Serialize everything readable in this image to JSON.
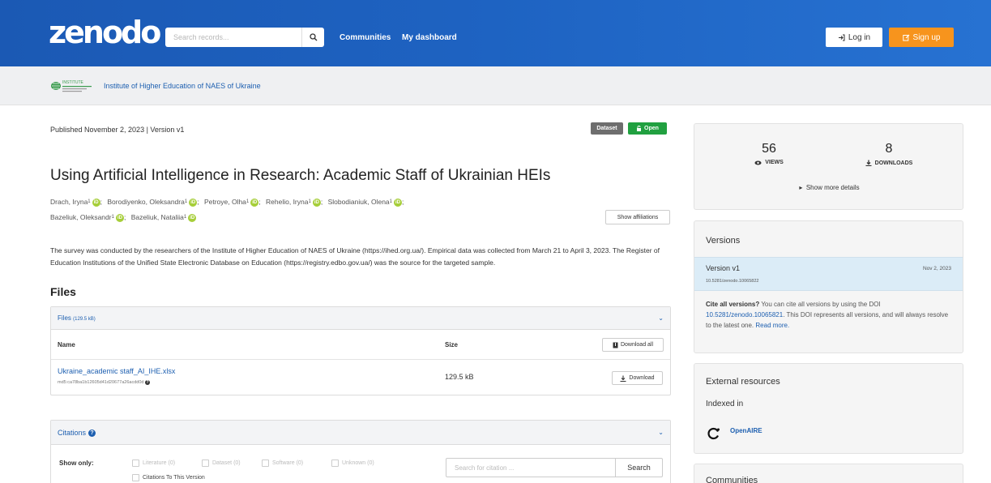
{
  "header": {
    "logo": "zenodo",
    "search_placeholder": "Search records...",
    "nav": [
      "Communities",
      "My dashboard"
    ],
    "login": "Log in",
    "signup": "Sign up",
    "colors": {
      "header_blue": "#1e63c2",
      "signup_orange": "#f7941d"
    }
  },
  "community": {
    "logo_text": "INSTITUTE",
    "name": "Institute of Higher Education of NAES of Ukraine"
  },
  "record": {
    "published": "Published November 2, 2023 | Version v1",
    "badges": {
      "type": "Dataset",
      "access": "Open"
    },
    "title": "Using Artificial Intelligence in Research: Academic Staff of Ukrainian HEIs",
    "creators": [
      "Drach, Iryna",
      "Borodiyenko, Oleksandra",
      "Petroye, Olha",
      "Rehelio, Iryna",
      "Slobodianiuk, Olena",
      "Bazeliuk, Oleksandr",
      "Bazeliuk, Nataliia"
    ],
    "affiliation_marker": "1",
    "show_affiliations": "Show affiliations",
    "description": "The survey was conducted by the researchers of the Institute of Higher Education of NAES of Ukraine (https://ihed.org.ua/). Empirical data was collected from March 21 to April 3, 2023. The Register of Education Institutions of the Unified State Electronic Database on Education (https://registry.edbo.gov.ua/) was the source for the targeted sample."
  },
  "files": {
    "heading": "Files",
    "panel_title": "Files",
    "panel_size": "(129.5 kB)",
    "col_name": "Name",
    "col_size": "Size",
    "download_all": "Download all",
    "items": [
      {
        "name": "Ukraine_academic staff_AI_IHE.xlsx",
        "md5": "md5:ca78ba1b12605d41d20677a26acdd0d",
        "size": "129.5 kB",
        "download": "Download"
      }
    ]
  },
  "citations": {
    "title": "Citations",
    "show_only": "Show only:",
    "filters": [
      "Literature (0)",
      "Dataset (0)",
      "Software (0)",
      "Unknown (0)"
    ],
    "this_version": "Citations To This Version",
    "search_placeholder": "Search for citation ...",
    "search_button": "Search"
  },
  "stats": {
    "views_count": "56",
    "views_label": "VIEWS",
    "downloads_count": "8",
    "downloads_label": "DOWNLOADS",
    "more": "Show more details"
  },
  "versions": {
    "title": "Versions",
    "current_label": "Version v1",
    "current_doi": "10.5281/zenodo.10065822",
    "current_date": "Nov 2, 2023",
    "cite_all_bold": "Cite all versions?",
    "cite_all_text": "You can cite all versions by using the DOI",
    "cite_all_doi": "10.5281/zenodo.10065821",
    "cite_all_rest": ". This DOI represents all versions, and will always resolve to the latest one.",
    "read_more": "Read more."
  },
  "external": {
    "title": "External resources",
    "indexed_in": "Indexed in",
    "openaire": "OpenAIRE"
  },
  "communities_box": {
    "title": "Communities"
  }
}
